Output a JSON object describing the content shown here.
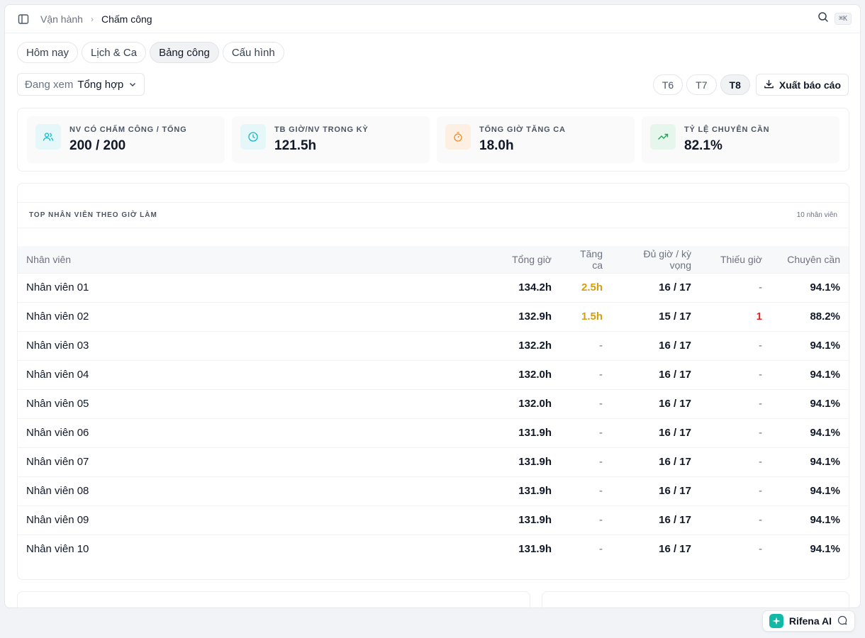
{
  "breadcrumb": {
    "parent": "Vận hành",
    "current": "Chấm công"
  },
  "search": {
    "shortcut": "⌘K"
  },
  "tabs": [
    {
      "label": "Hôm nay"
    },
    {
      "label": "Lịch & Ca"
    },
    {
      "label": "Bảng công",
      "active": true
    },
    {
      "label": "Cấu hình"
    }
  ],
  "view_select": {
    "label": "Đang xem",
    "value": "Tổng hợp"
  },
  "months": [
    {
      "label": "T6"
    },
    {
      "label": "T7"
    },
    {
      "label": "T8",
      "active": true
    }
  ],
  "export": {
    "label": "Xuất báo cáo"
  },
  "kpis": [
    {
      "label": "NV CÓ CHẤM CÔNG / TỔNG",
      "value": "200 / 200",
      "icon": "users-icon",
      "color": "#14b8c8"
    },
    {
      "label": "TB GIỜ/NV TRONG KỲ",
      "value": "121.5h",
      "icon": "clock-icon",
      "color": "#14b8c8"
    },
    {
      "label": "TỔNG GIỜ TĂNG CA",
      "value": "18.0h",
      "icon": "stopwatch-icon",
      "color": "#f08a24"
    },
    {
      "label": "TỶ LỆ CHUYÊN CẦN",
      "value": "82.1%",
      "icon": "trending-up-icon",
      "color": "#22a65a"
    }
  ],
  "top_table": {
    "title": "TOP NHÂN VIÊN THEO GIỜ LÀM",
    "count": "10 nhân viên",
    "columns": [
      "Nhân viên",
      "Tổng giờ",
      "Tăng ca",
      "Đủ giờ / kỳ vọng",
      "Thiếu giờ",
      "Chuyên cần"
    ],
    "rows": [
      {
        "name": "Nhân viên 01",
        "total": "134.2h",
        "overtime": "2.5h",
        "full": "16 / 17",
        "short": "-",
        "attendance": "94.1%"
      },
      {
        "name": "Nhân viên 02",
        "total": "132.9h",
        "overtime": "1.5h",
        "full": "15 / 17",
        "short": "1",
        "attendance": "88.2%"
      },
      {
        "name": "Nhân viên 03",
        "total": "132.2h",
        "overtime": "-",
        "full": "16 / 17",
        "short": "-",
        "attendance": "94.1%"
      },
      {
        "name": "Nhân viên 04",
        "total": "132.0h",
        "overtime": "-",
        "full": "16 / 17",
        "short": "-",
        "attendance": "94.1%"
      },
      {
        "name": "Nhân viên 05",
        "total": "132.0h",
        "overtime": "-",
        "full": "16 / 17",
        "short": "-",
        "attendance": "94.1%"
      },
      {
        "name": "Nhân viên 06",
        "total": "131.9h",
        "overtime": "-",
        "full": "16 / 17",
        "short": "-",
        "attendance": "94.1%"
      },
      {
        "name": "Nhân viên 07",
        "total": "131.9h",
        "overtime": "-",
        "full": "16 / 17",
        "short": "-",
        "attendance": "94.1%"
      },
      {
        "name": "Nhân viên 08",
        "total": "131.9h",
        "overtime": "-",
        "full": "16 / 17",
        "short": "-",
        "attendance": "94.1%"
      },
      {
        "name": "Nhân viên 09",
        "total": "131.9h",
        "overtime": "-",
        "full": "16 / 17",
        "short": "-",
        "attendance": "94.1%"
      },
      {
        "name": "Nhân viên 10",
        "total": "131.9h",
        "overtime": "-",
        "full": "16 / 17",
        "short": "-",
        "attendance": "94.1%"
      }
    ]
  },
  "ai_button": {
    "label": "Rifena AI"
  }
}
